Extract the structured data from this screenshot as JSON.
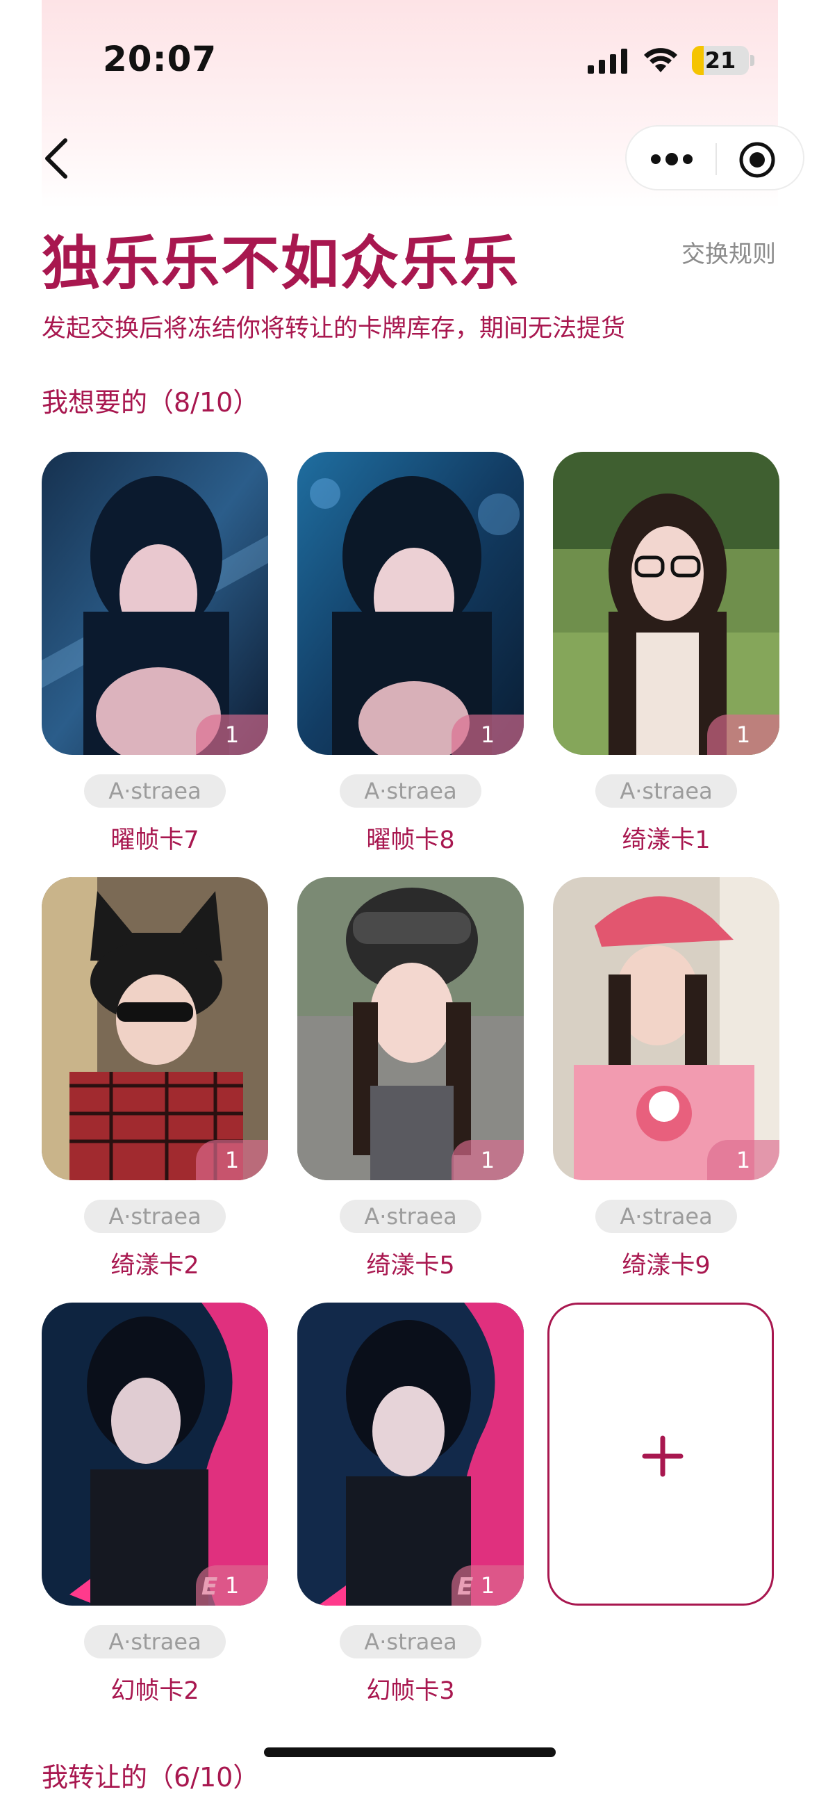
{
  "status_bar": {
    "time": "20:07",
    "battery": "21",
    "battery_level": 0.21
  },
  "header": {
    "back_icon": "chevron-left-icon",
    "more_icon": "more-dots-icon",
    "close_icon": "target-circle-icon"
  },
  "page": {
    "title": "独乐乐不如众乐乐",
    "rules_link": "交换规则",
    "subtitle": "发起交换后将冻结你将转让的卡牌库存，期间无法提货"
  },
  "want_section": {
    "title": "我想要的（8/10）",
    "cards": [
      {
        "brand": "A·straea",
        "name": "曜帧卡7",
        "qty": "1"
      },
      {
        "brand": "A·straea",
        "name": "曜帧卡8",
        "qty": "1"
      },
      {
        "brand": "A·straea",
        "name": "绮漾卡1",
        "qty": "1"
      },
      {
        "brand": "A·straea",
        "name": "绮漾卡2",
        "qty": "1"
      },
      {
        "brand": "A·straea",
        "name": "绮漾卡5",
        "qty": "1"
      },
      {
        "brand": "A·straea",
        "name": "绮漾卡9",
        "qty": "1"
      },
      {
        "brand": "A·straea",
        "name": "幻帧卡2",
        "qty": "1"
      },
      {
        "brand": "A·straea",
        "name": "幻帧卡3",
        "qty": "1"
      }
    ],
    "add_icon": "plus-icon"
  },
  "give_section": {
    "title": "我转让的（6/10）"
  },
  "colors": {
    "accent": "#a8174f",
    "badge": "#db6c8f"
  }
}
